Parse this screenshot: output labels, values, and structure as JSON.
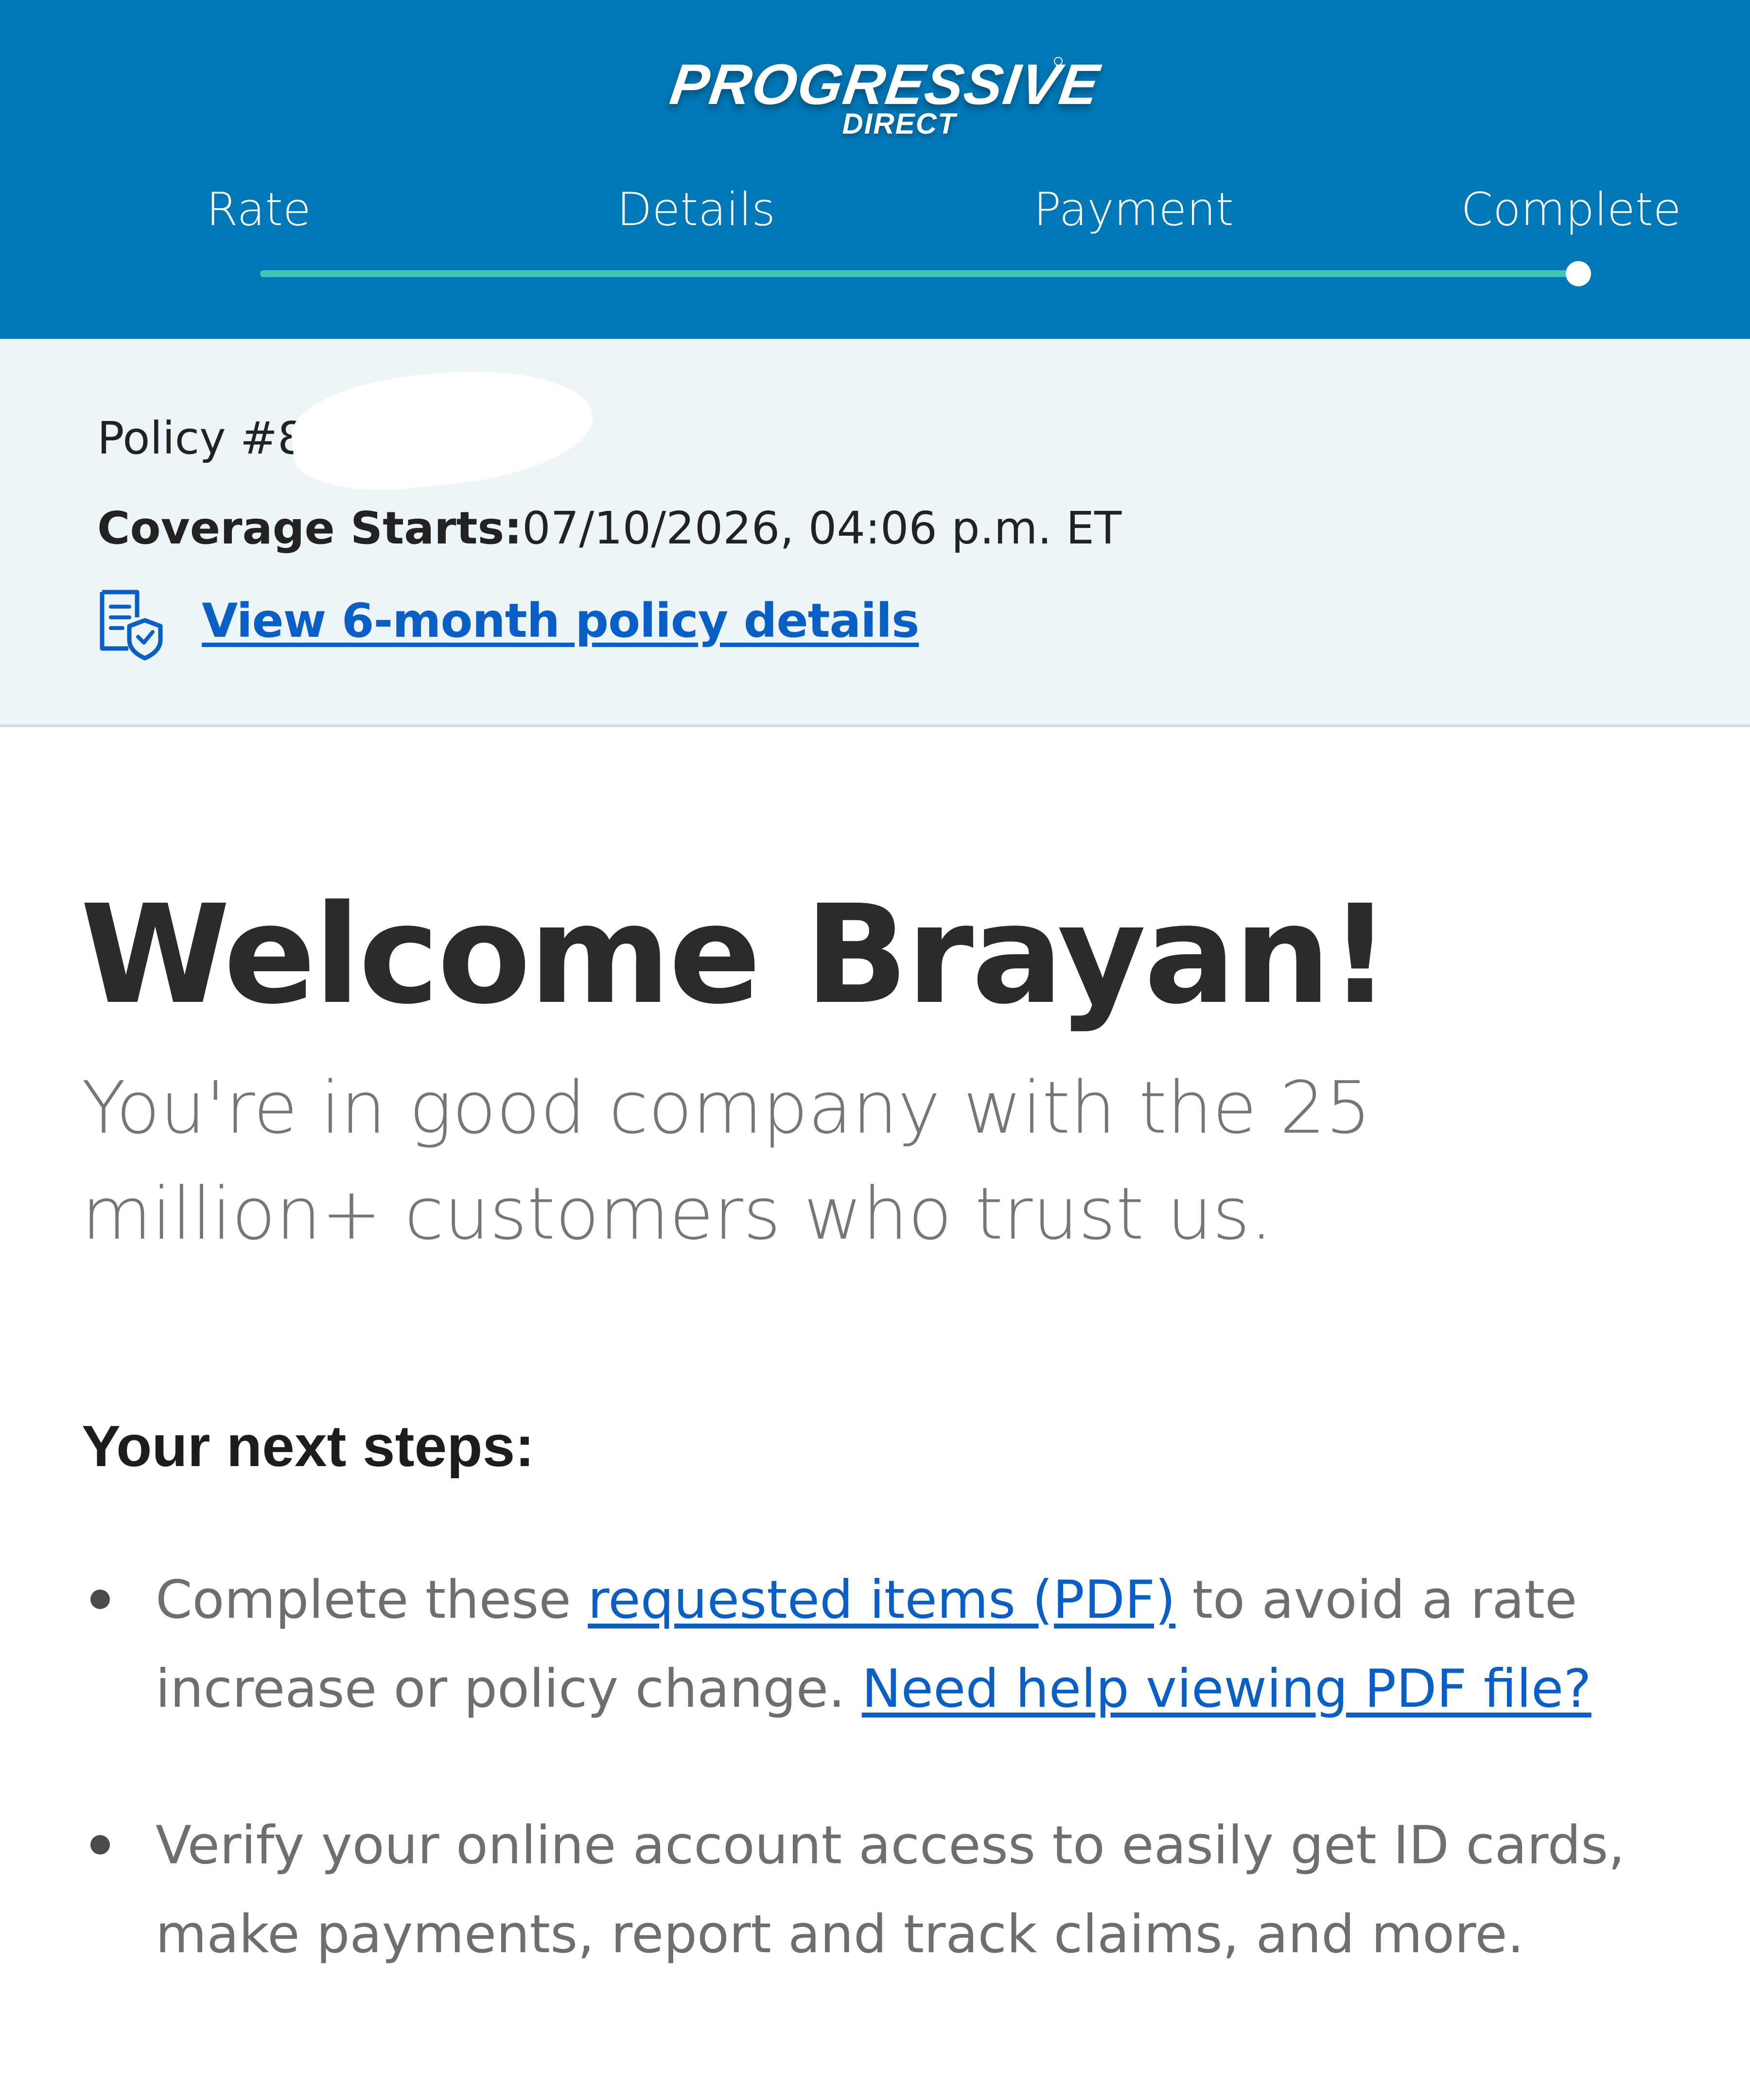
{
  "header": {
    "logo_text": "PROGRESSIVE",
    "logo_subtext": "DIRECT",
    "background_color": "#0077b6",
    "progress_color": "#3fc6b5",
    "steps": [
      {
        "label": "Rate"
      },
      {
        "label": "Details"
      },
      {
        "label": "Payment"
      },
      {
        "label": "Complete"
      }
    ],
    "current_step": "Complete",
    "progress_fraction": 1.0
  },
  "policy": {
    "policy_number_label": "Policy #",
    "policy_number_visible_fragment": "8",
    "coverage_label": "Coverage Starts:",
    "coverage_value": "07/10/2026, 04:06 p.m. ET",
    "details_link": "View 6-month policy details",
    "details_icon": "policy-document-shield-icon"
  },
  "main": {
    "welcome": "Welcome Brayan!",
    "tagline": "You're in good company with the 25 million+ customers who trust us.",
    "next_steps_heading": "Your next steps:",
    "next_steps": [
      {
        "text_before": "Complete these ",
        "link1": "requested items (PDF)",
        "text_middle": " to avoid a rate increase or policy change. ",
        "link2": "Need help viewing PDF file?"
      },
      {
        "text": "Verify your online account access to easily get ID cards, make payments, report and track claims, and more."
      }
    ]
  },
  "colors": {
    "link": "#0a5fc6",
    "heading": "#2b2b2b",
    "muted_text": "#767676",
    "band_background": "#eef5f9"
  }
}
